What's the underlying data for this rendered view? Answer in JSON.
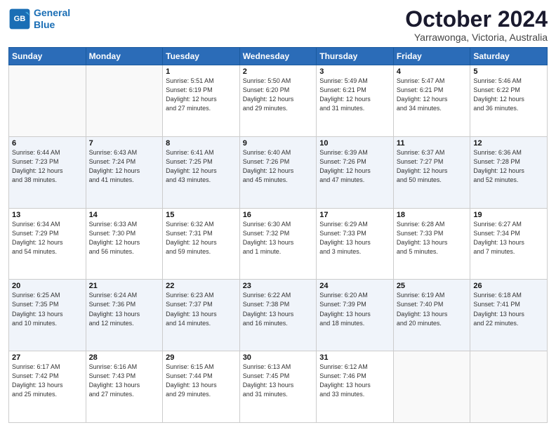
{
  "logo": {
    "line1": "General",
    "line2": "Blue"
  },
  "title": "October 2024",
  "location": "Yarrawonga, Victoria, Australia",
  "days_header": [
    "Sunday",
    "Monday",
    "Tuesday",
    "Wednesday",
    "Thursday",
    "Friday",
    "Saturday"
  ],
  "weeks": [
    [
      {
        "num": "",
        "info": ""
      },
      {
        "num": "",
        "info": ""
      },
      {
        "num": "1",
        "info": "Sunrise: 5:51 AM\nSunset: 6:19 PM\nDaylight: 12 hours\nand 27 minutes."
      },
      {
        "num": "2",
        "info": "Sunrise: 5:50 AM\nSunset: 6:20 PM\nDaylight: 12 hours\nand 29 minutes."
      },
      {
        "num": "3",
        "info": "Sunrise: 5:49 AM\nSunset: 6:21 PM\nDaylight: 12 hours\nand 31 minutes."
      },
      {
        "num": "4",
        "info": "Sunrise: 5:47 AM\nSunset: 6:21 PM\nDaylight: 12 hours\nand 34 minutes."
      },
      {
        "num": "5",
        "info": "Sunrise: 5:46 AM\nSunset: 6:22 PM\nDaylight: 12 hours\nand 36 minutes."
      }
    ],
    [
      {
        "num": "6",
        "info": "Sunrise: 6:44 AM\nSunset: 7:23 PM\nDaylight: 12 hours\nand 38 minutes."
      },
      {
        "num": "7",
        "info": "Sunrise: 6:43 AM\nSunset: 7:24 PM\nDaylight: 12 hours\nand 41 minutes."
      },
      {
        "num": "8",
        "info": "Sunrise: 6:41 AM\nSunset: 7:25 PM\nDaylight: 12 hours\nand 43 minutes."
      },
      {
        "num": "9",
        "info": "Sunrise: 6:40 AM\nSunset: 7:26 PM\nDaylight: 12 hours\nand 45 minutes."
      },
      {
        "num": "10",
        "info": "Sunrise: 6:39 AM\nSunset: 7:26 PM\nDaylight: 12 hours\nand 47 minutes."
      },
      {
        "num": "11",
        "info": "Sunrise: 6:37 AM\nSunset: 7:27 PM\nDaylight: 12 hours\nand 50 minutes."
      },
      {
        "num": "12",
        "info": "Sunrise: 6:36 AM\nSunset: 7:28 PM\nDaylight: 12 hours\nand 52 minutes."
      }
    ],
    [
      {
        "num": "13",
        "info": "Sunrise: 6:34 AM\nSunset: 7:29 PM\nDaylight: 12 hours\nand 54 minutes."
      },
      {
        "num": "14",
        "info": "Sunrise: 6:33 AM\nSunset: 7:30 PM\nDaylight: 12 hours\nand 56 minutes."
      },
      {
        "num": "15",
        "info": "Sunrise: 6:32 AM\nSunset: 7:31 PM\nDaylight: 12 hours\nand 59 minutes."
      },
      {
        "num": "16",
        "info": "Sunrise: 6:30 AM\nSunset: 7:32 PM\nDaylight: 13 hours\nand 1 minute."
      },
      {
        "num": "17",
        "info": "Sunrise: 6:29 AM\nSunset: 7:33 PM\nDaylight: 13 hours\nand 3 minutes."
      },
      {
        "num": "18",
        "info": "Sunrise: 6:28 AM\nSunset: 7:33 PM\nDaylight: 13 hours\nand 5 minutes."
      },
      {
        "num": "19",
        "info": "Sunrise: 6:27 AM\nSunset: 7:34 PM\nDaylight: 13 hours\nand 7 minutes."
      }
    ],
    [
      {
        "num": "20",
        "info": "Sunrise: 6:25 AM\nSunset: 7:35 PM\nDaylight: 13 hours\nand 10 minutes."
      },
      {
        "num": "21",
        "info": "Sunrise: 6:24 AM\nSunset: 7:36 PM\nDaylight: 13 hours\nand 12 minutes."
      },
      {
        "num": "22",
        "info": "Sunrise: 6:23 AM\nSunset: 7:37 PM\nDaylight: 13 hours\nand 14 minutes."
      },
      {
        "num": "23",
        "info": "Sunrise: 6:22 AM\nSunset: 7:38 PM\nDaylight: 13 hours\nand 16 minutes."
      },
      {
        "num": "24",
        "info": "Sunrise: 6:20 AM\nSunset: 7:39 PM\nDaylight: 13 hours\nand 18 minutes."
      },
      {
        "num": "25",
        "info": "Sunrise: 6:19 AM\nSunset: 7:40 PM\nDaylight: 13 hours\nand 20 minutes."
      },
      {
        "num": "26",
        "info": "Sunrise: 6:18 AM\nSunset: 7:41 PM\nDaylight: 13 hours\nand 22 minutes."
      }
    ],
    [
      {
        "num": "27",
        "info": "Sunrise: 6:17 AM\nSunset: 7:42 PM\nDaylight: 13 hours\nand 25 minutes."
      },
      {
        "num": "28",
        "info": "Sunrise: 6:16 AM\nSunset: 7:43 PM\nDaylight: 13 hours\nand 27 minutes."
      },
      {
        "num": "29",
        "info": "Sunrise: 6:15 AM\nSunset: 7:44 PM\nDaylight: 13 hours\nand 29 minutes."
      },
      {
        "num": "30",
        "info": "Sunrise: 6:13 AM\nSunset: 7:45 PM\nDaylight: 13 hours\nand 31 minutes."
      },
      {
        "num": "31",
        "info": "Sunrise: 6:12 AM\nSunset: 7:46 PM\nDaylight: 13 hours\nand 33 minutes."
      },
      {
        "num": "",
        "info": ""
      },
      {
        "num": "",
        "info": ""
      }
    ]
  ]
}
